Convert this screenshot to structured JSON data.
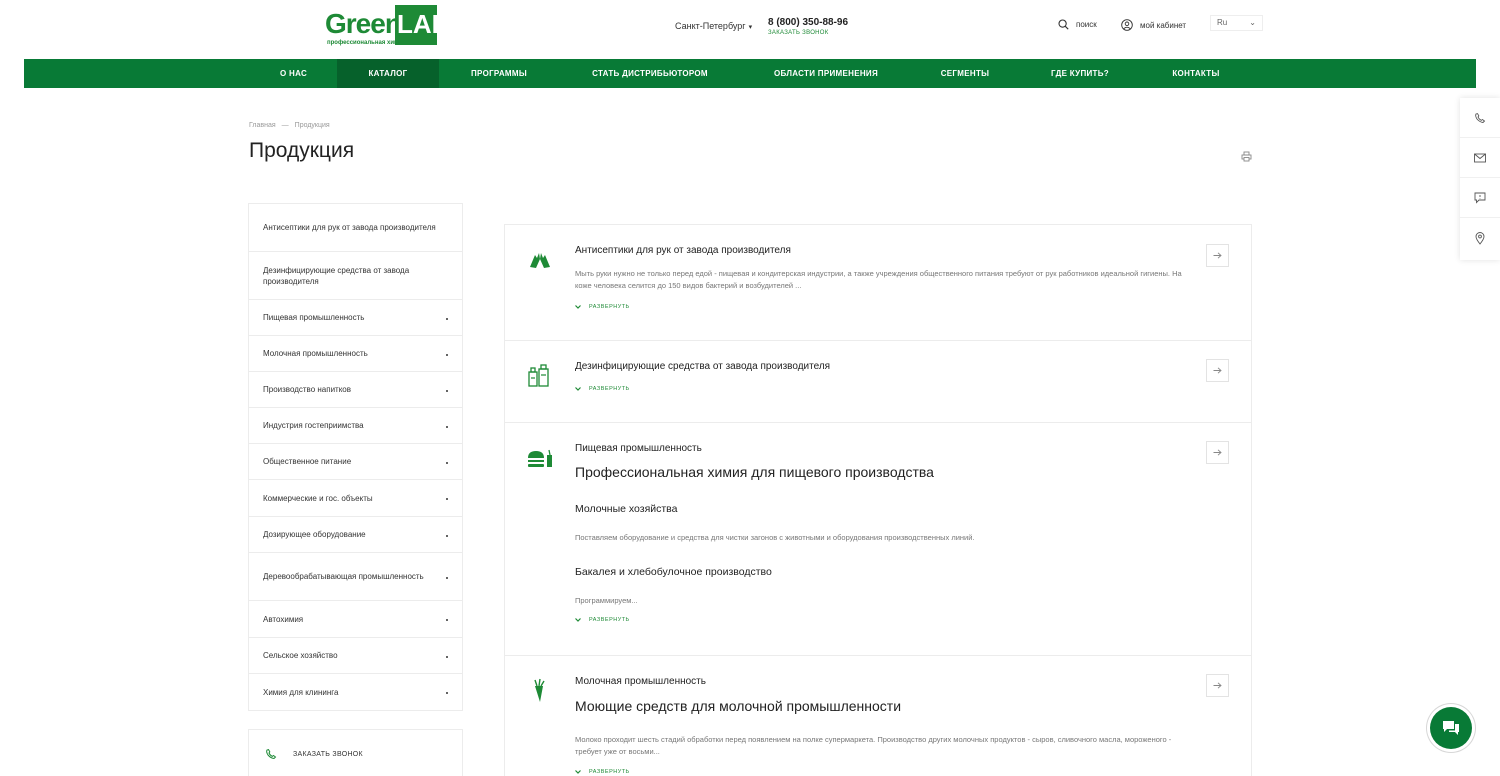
{
  "header": {
    "logo_main": "Green",
    "logo_lab": "LAB",
    "logo_sub": "профессиональная химия",
    "city": "Санкт-Петербург",
    "phone": "8 (800) 350-88-96",
    "callback_link": "Заказать звонок",
    "search_label": "поиск",
    "cabinet_label": "мой кабинет",
    "lang": "Ru"
  },
  "nav": {
    "items": [
      {
        "label": "О НАС"
      },
      {
        "label": "КАТАЛОГ"
      },
      {
        "label": "ПРОГРАММЫ"
      },
      {
        "label": "СТАТЬ ДИСТРИБЬЮТОРОМ"
      },
      {
        "label": "ОБЛАСТИ ПРИМЕНЕНИЯ"
      },
      {
        "label": "СЕГМЕНТЫ"
      },
      {
        "label": "ГДЕ КУПИТЬ?"
      },
      {
        "label": "КОНТАКТЫ"
      }
    ],
    "active_index": 1
  },
  "breadcrumb": {
    "home": "Главная",
    "sep": "—",
    "current": "Продукция"
  },
  "page_title": "Продукция",
  "sidebar": {
    "items": [
      {
        "label": "Антисептики для рук от завода производителя"
      },
      {
        "label": "Дезинфицирующие средства от завода производителя"
      },
      {
        "label": "Пищевая промышленность"
      },
      {
        "label": "Молочная промышленность"
      },
      {
        "label": "Производство напитков"
      },
      {
        "label": "Индустрия гостеприимства"
      },
      {
        "label": "Общественное питание"
      },
      {
        "label": "Коммерческие и гос. объекты"
      },
      {
        "label": "Дозирующее оборудование"
      },
      {
        "label": "Деревообрабатывающая промышленность"
      },
      {
        "label": "Автохимия"
      },
      {
        "label": "Сельское хозяйство"
      },
      {
        "label": "Химия для клининга"
      }
    ],
    "callback_label": "Заказать звонок"
  },
  "catalog": {
    "expand_label": "развернуть",
    "blocks": [
      {
        "title": "Антисептики для рук от завода производителя",
        "desc": "Мыть руки нужно не только перед едой - пищевая и кондитерская индустрии, а также учреждения общественного питания требуют от рук работников идеальной гигиены. На коже человека селится до 150 видов бактерий и возбудителей ..."
      },
      {
        "title": "Дезинфицирующие средства от завода производителя"
      },
      {
        "title": "Пищевая промышленность",
        "subtitle": "Профессиональная химия для пищевого производства",
        "sub1_title": "Молочные хозяйства",
        "sub1_desc": "Поставляем оборудование и средства для чистки загонов с животными и оборудования производственных линий.",
        "sub2_title": "Бакалея и хлебобулочное производство",
        "sub2_desc": "Программируем..."
      },
      {
        "title": "Молочная промышленность",
        "subtitle": "Моющие средств для молочной промышленности",
        "desc": "Молоко проходит шесть стадий обработки перед появлением на полке супермаркета. Производство других молочных продуктов - сыров, сливочного масла, мороженого - требует уже от восьми..."
      }
    ]
  },
  "colors": {
    "brand": "#087a36",
    "brand_dark": "#06612b",
    "accent": "#1e8a36"
  },
  "icons": [
    "search-icon",
    "user-icon",
    "print-icon",
    "phone-icon",
    "mail-icon",
    "message-icon",
    "location-icon",
    "chat-icon",
    "arrow-right-icon",
    "chevron-down-icon",
    "gloves-icon",
    "bottles-icon",
    "burger-icon",
    "carrot-icon"
  ]
}
